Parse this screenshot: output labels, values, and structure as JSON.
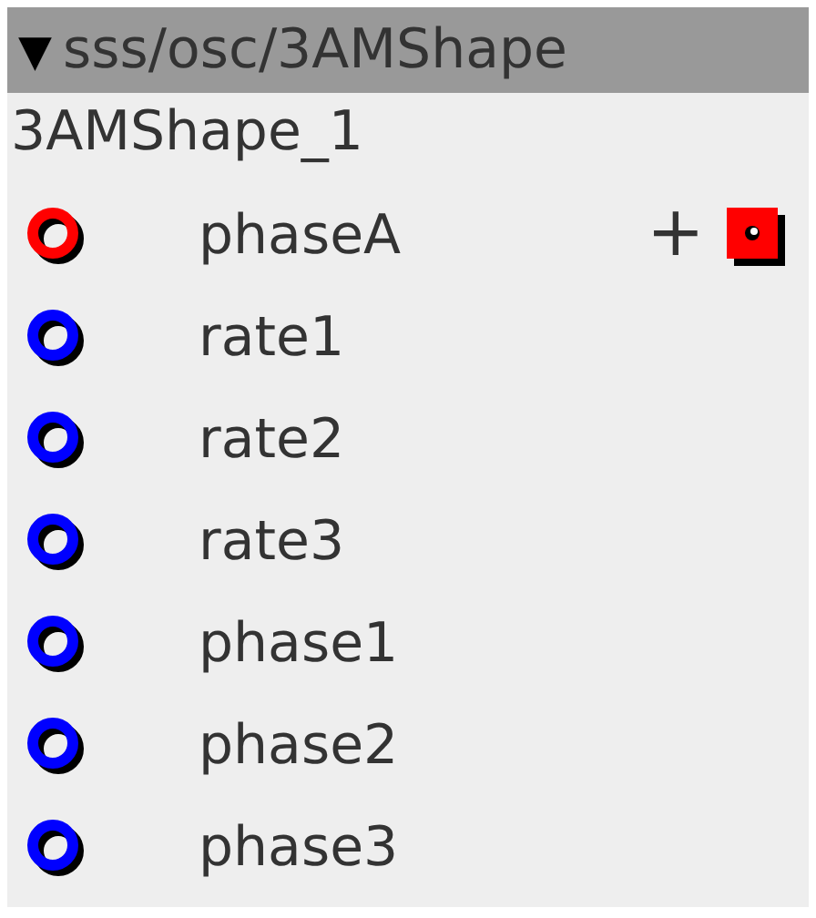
{
  "header": {
    "arrow": "▼",
    "title": "sss/osc/3AMShape",
    "expanded": true
  },
  "node_title": "3AMShape_1",
  "inputs": [
    {
      "name": "phaseA",
      "color": "#ff0000",
      "kind": "modulated",
      "add_label": "+"
    },
    {
      "name": "rate1",
      "color": "#0000ff",
      "kind": "plain"
    },
    {
      "name": "rate2",
      "color": "#0000ff",
      "kind": "plain"
    },
    {
      "name": "rate3",
      "color": "#0000ff",
      "kind": "plain"
    },
    {
      "name": "phase1",
      "color": "#0000ff",
      "kind": "plain"
    },
    {
      "name": "phase2",
      "color": "#0000ff",
      "kind": "plain"
    },
    {
      "name": "phase3",
      "color": "#0000ff",
      "kind": "plain"
    }
  ]
}
